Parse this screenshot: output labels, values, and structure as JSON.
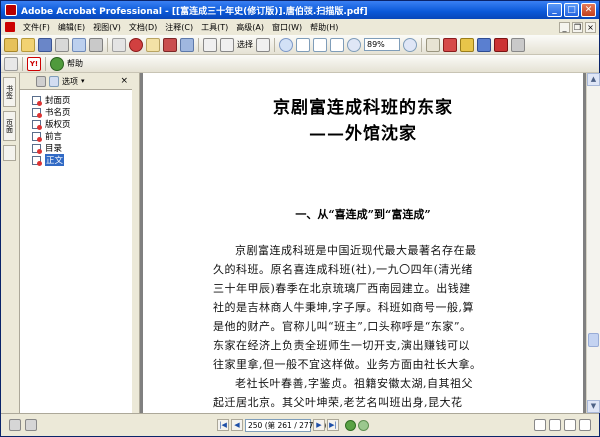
{
  "window": {
    "title": "Adobe Acrobat Professional - [[富连成三十年史(修订版)].唐伯弢.扫描版.pdf]"
  },
  "menu": {
    "items": [
      "文件(F)",
      "编辑(E)",
      "视图(V)",
      "文档(D)",
      "注释(C)",
      "工具(T)",
      "高级(A)",
      "窗口(W)",
      "帮助(H)"
    ]
  },
  "toolbar": {
    "select_label": "选择",
    "zoom_value": "89%",
    "help_label": "帮助"
  },
  "side_tabs": {
    "bookmarks": "书签",
    "pages": "页面"
  },
  "bookmarks_panel": {
    "options_label": "选项",
    "items": [
      {
        "label": "封面页"
      },
      {
        "label": "书名页"
      },
      {
        "label": "版权页"
      },
      {
        "label": "前言"
      },
      {
        "label": "目录"
      },
      {
        "label": "正文"
      }
    ]
  },
  "document": {
    "title": "京剧富连成科班的东家",
    "subtitle": "——外馆沈家",
    "section_heading": "一、从“喜连成”到“富连成”",
    "paragraph_lines": [
      "京剧富连成科班是中国近现代最大最著名存在最",
      "久的科班。原名喜连成科班(社),一九〇四年(清光绪",
      "三十年甲辰)春季在北京琉璃厂西南园建立。出钱建",
      "社的是吉林商人牛秉坤,字子厚。科班如商号一般,算",
      "是他的财产。官称儿叫“班主”,口头称呼是“东家”。",
      "东家在经济上负责全班师生一切开支,演出赚钱可以",
      "往家里拿,但一般不宜这样做。业务方面由社长大拿。",
      "老社长叶春善,字鉴贞。祖籍安徽太湖,自其祖父",
      "起迁居北京。其父叶坤荣,老艺名叫班出身,昆大花"
    ]
  },
  "statusbar": {
    "page_indicator": "250 (第 261 / 277 页)"
  }
}
